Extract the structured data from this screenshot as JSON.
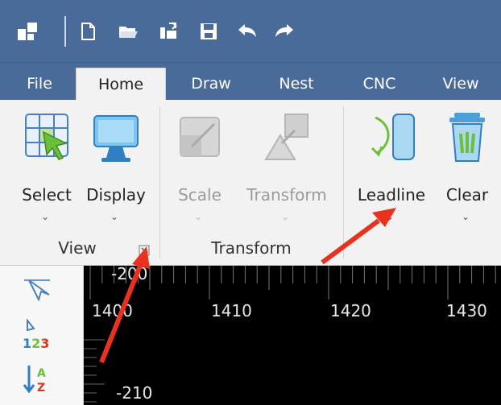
{
  "tabs": [
    {
      "label": "File"
    },
    {
      "label": "Home"
    },
    {
      "label": "Draw"
    },
    {
      "label": "Nest"
    },
    {
      "label": "CNC"
    },
    {
      "label": "View"
    }
  ],
  "ribbon": {
    "buttons": {
      "select": "Select",
      "display": "Display",
      "scale": "Scale",
      "transform": "Transform",
      "leadline": "Leadline",
      "clear": "Clear"
    },
    "groups": {
      "view": "View",
      "transform": "Transform"
    }
  },
  "canvas": {
    "ruler_top_label": "-200",
    "ticks": [
      "1400",
      "1410",
      "1420",
      "1430"
    ],
    "bottom_label": "-210"
  },
  "sidebar": {
    "numbers_label": "123",
    "sort_label": "AZ"
  },
  "colors": {
    "title_bar": "#4a6b9a",
    "ribbon_bg": "#f2f2f2",
    "annotation_arrow": "#e8321e"
  }
}
